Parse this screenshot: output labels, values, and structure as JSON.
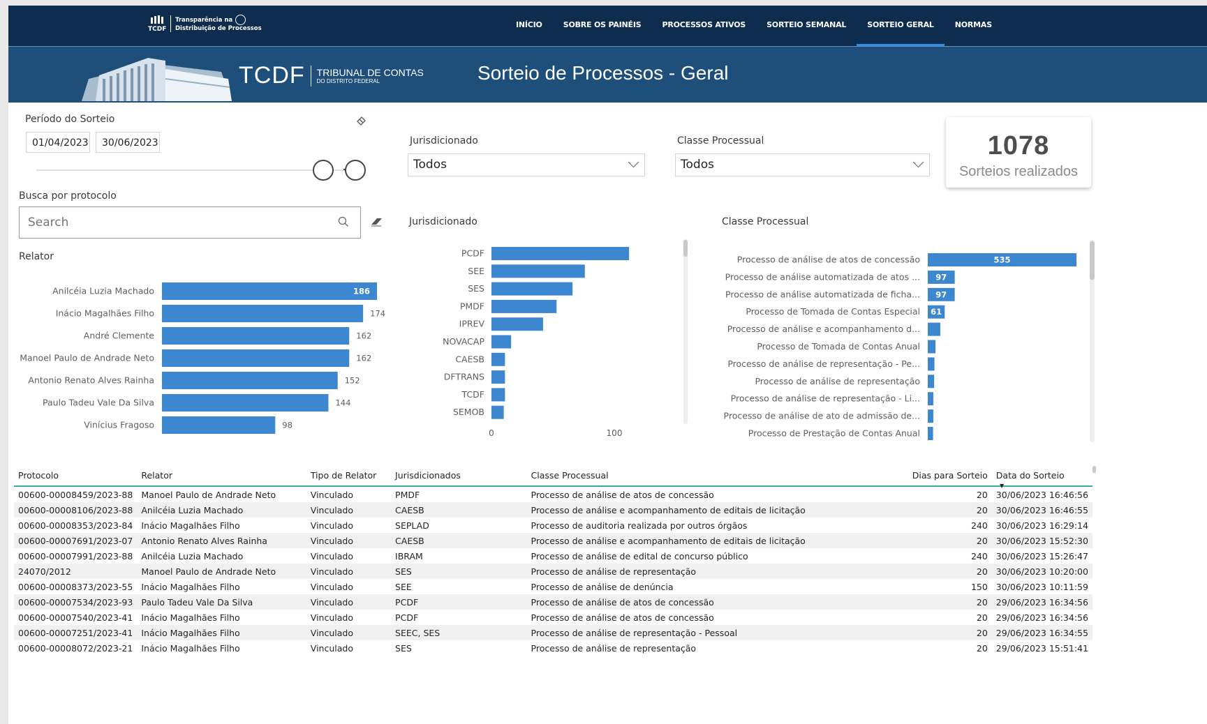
{
  "nav": {
    "logo_mark": "TCDF",
    "logo_line1": "Transparência na",
    "logo_line2": "Distribuição de Processos",
    "items": [
      {
        "label": "INÍCIO",
        "active": false
      },
      {
        "label": "SOBRE OS PAINÉIS",
        "active": false
      },
      {
        "label": "PROCESSOS ATIVOS",
        "active": false
      },
      {
        "label": "SORTEIO SEMANAL",
        "active": false
      },
      {
        "label": "SORTEIO GERAL",
        "active": true
      },
      {
        "label": "NORMAS",
        "active": false
      }
    ]
  },
  "banner": {
    "tcdf": "TCDF",
    "tribunal": "TRIBUNAL DE CONTAS",
    "distrito": "DO DISTRITO FEDERAL",
    "title": "Sorteio de Processos - Geral"
  },
  "filters": {
    "periodo_label": "Período do Sorteio",
    "date_start": "01/04/2023",
    "date_end": "30/06/2023",
    "jurisdicionado_label": "Jurisdicionado",
    "jurisdicionado_value": "Todos",
    "classe_label": "Classe Processual",
    "classe_value": "Todos",
    "busca_label": "Busca por protocolo",
    "search_placeholder": "Search"
  },
  "kpi": {
    "value": "1078",
    "caption": "Sorteios realizados"
  },
  "relator_chart_title": "Relator",
  "jurisdicionado_chart_title": "Jurisdicionado",
  "classe_chart_title": "Classe Processual",
  "colors": {
    "bar": "#3c87cf",
    "nav_bg": "#0d2c4e",
    "banner_bg": "#1e4f7b",
    "accent": "#2b8ee8"
  },
  "chart_data": [
    {
      "type": "bar",
      "orientation": "horizontal",
      "title": "Relator",
      "categories": [
        "Anilcéia Luzia Machado",
        "Inácio Magalhães Filho",
        "André Clemente",
        "Manoel Paulo de Andrade Neto",
        "Antonio Renato Alves Rainha",
        "Paulo Tadeu Vale Da Silva",
        "Vinícius Fragoso"
      ],
      "values": [
        186,
        174,
        162,
        162,
        152,
        144,
        98
      ]
    },
    {
      "type": "bar",
      "orientation": "horizontal",
      "title": "Jurisdicionado",
      "categories": [
        "PCDF",
        "SEE",
        "SES",
        "PMDF",
        "IPREV",
        "NOVACAP",
        "CAESB",
        "DFTRANS",
        "TCDF",
        "SEMOB"
      ],
      "values": [
        112,
        76,
        66,
        53,
        42,
        16,
        11,
        11,
        11,
        10
      ],
      "x_ticks": [
        "0",
        "100"
      ],
      "xlim": [
        0,
        112
      ]
    },
    {
      "type": "bar",
      "orientation": "horizontal",
      "title": "Classe Processual",
      "categories": [
        "Processo de análise de atos de concessão",
        "Processo de análise automatizada de atos ...",
        "Processo de análise automatizada de ficha...",
        "Processo de Tomada de Contas Especial",
        "Processo de análise e acompanhamento d...",
        "Processo de Tomada de Contas Anual",
        "Processo de análise de representação - Pe...",
        "Processo de análise de representação",
        "Processo de análise de representação - Li...",
        "Processo de análise de ato de admissão de...",
        "Processo de Prestação de Contas Anual"
      ],
      "values": [
        535,
        97,
        97,
        61,
        45,
        28,
        24,
        23,
        20,
        20,
        19
      ],
      "labels": [
        "535",
        "97",
        "97",
        "61",
        "",
        "",
        "",
        "",
        "",
        "",
        ""
      ]
    }
  ],
  "table": {
    "headers": [
      "Protocolo",
      "Relator",
      "Tipo de Relator",
      "Jurisdicionados",
      "Classe Processual",
      "Dias para Sorteio",
      "Data do Sorteio"
    ],
    "rows": [
      [
        "00600-00008459/2023-88",
        "Manoel Paulo de Andrade Neto",
        "Vinculado",
        "PMDF",
        "Processo de análise de atos de concessão",
        "20",
        "30/06/2023 16:46:56"
      ],
      [
        "00600-00008106/2023-88",
        "Anilcéia Luzia Machado",
        "Vinculado",
        "CAESB",
        "Processo de análise e acompanhamento de editais de licitação",
        "20",
        "30/06/2023 16:46:55"
      ],
      [
        "00600-00008353/2023-84",
        "Inácio Magalhães Filho",
        "Vinculado",
        "SEPLAD",
        "Processo de auditoria realizada por outros órgãos",
        "240",
        "30/06/2023 16:29:14"
      ],
      [
        "00600-00007691/2023-07",
        "Antonio Renato Alves Rainha",
        "Vinculado",
        "CAESB",
        "Processo de análise e acompanhamento de editais de licitação",
        "20",
        "30/06/2023 15:52:30"
      ],
      [
        "00600-00007991/2023-88",
        "Anilcéia Luzia Machado",
        "Vinculado",
        "IBRAM",
        "Processo de análise de edital de concurso público",
        "240",
        "30/06/2023 15:26:47"
      ],
      [
        "24070/2012",
        "Manoel Paulo de Andrade Neto",
        "Vinculado",
        "SES",
        "Processo de análise de representação",
        "20",
        "30/06/2023 10:20:00"
      ],
      [
        "00600-00008373/2023-55",
        "Inácio Magalhães Filho",
        "Vinculado",
        "SEE",
        "Processo de análise de denúncia",
        "150",
        "30/06/2023 10:11:59"
      ],
      [
        "00600-00007534/2023-93",
        "Paulo Tadeu Vale Da Silva",
        "Vinculado",
        "PCDF",
        "Processo de análise de atos de concessão",
        "20",
        "29/06/2023 16:34:56"
      ],
      [
        "00600-00007540/2023-41",
        "Inácio Magalhães Filho",
        "Vinculado",
        "PCDF",
        "Processo de análise de atos de concessão",
        "20",
        "29/06/2023 16:34:56"
      ],
      [
        "00600-00007251/2023-41",
        "Inácio Magalhães Filho",
        "Vinculado",
        "SEEC, SES",
        "Processo de análise de representação - Pessoal",
        "20",
        "29/06/2023 16:34:55"
      ],
      [
        "00600-00008072/2023-21",
        "Inácio Magalhães Filho",
        "Vinculado",
        "SES",
        "Processo de análise de representação",
        "20",
        "29/06/2023 15:51:41"
      ]
    ]
  }
}
